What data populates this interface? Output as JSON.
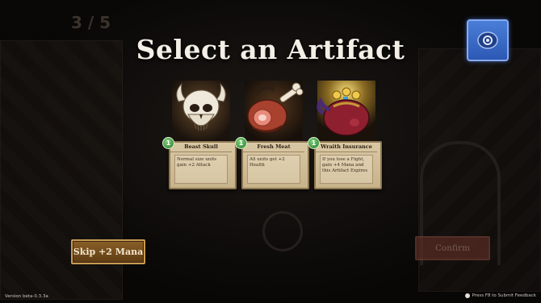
{
  "screen": {
    "title": "Select an Artifact"
  },
  "artifacts": [
    {
      "name": "Beast Skull",
      "cost": "1",
      "description": "Normal size units gain +2 Attack",
      "icon": "skull-icon"
    },
    {
      "name": "Fresh Meat",
      "cost": "1",
      "description": "All units get +2 Health",
      "icon": "meat-icon"
    },
    {
      "name": "Wraith Insurance",
      "cost": "1",
      "description": "If you lose a Fight, gain +4 Mana and this Artifact Expires",
      "icon": "treasure-sack-icon"
    }
  ],
  "buttons": {
    "skip_label": "Skip +2 Mana",
    "confirm_label": "Confirm"
  },
  "footer": {
    "version": "Version beta-0.3.3a",
    "feedback": "Press F8 to Submit Feedback"
  },
  "background": {
    "counter": "3 / 5"
  },
  "colors": {
    "card_parchment": "#d9c8a4",
    "cost_green": "#2c7a2c",
    "skip_button": "#8a5f28",
    "confirm_disabled": "#5a2d24",
    "top_button_blue": "#2c58b4"
  }
}
